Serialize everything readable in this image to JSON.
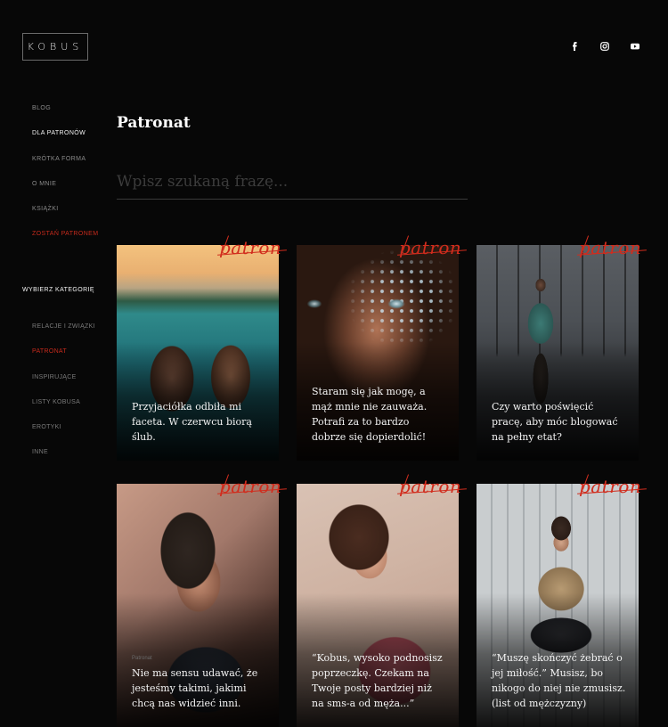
{
  "logo": "KOBUS",
  "social": [
    "facebook-icon",
    "instagram-icon",
    "youtube-icon"
  ],
  "nav": [
    "BLOG",
    "DLA PATRONÓW",
    "KRÓTKA FORMA",
    "O MNIE",
    "KSIĄŻKI",
    "ZOSTAŃ PATRONEM"
  ],
  "categories": {
    "heading": "WYBIERZ KATEGORIĘ",
    "items": [
      "RELACJE I ZWIĄZKI",
      "PATRONAT",
      "INSPIRUJĄCE",
      "LISTY KOBUSA",
      "EROTYKI",
      "INNE"
    ]
  },
  "page_title": "Patronat",
  "search": {
    "placeholder": "Wpisz szukaną frazę..."
  },
  "badge_text": "patron",
  "cards": [
    {
      "caption": "Przyjaciółka odbiła mi faceta. W czerwcu biorą ślub."
    },
    {
      "caption": "Staram się jak mogę, a mąż mnie nie zauważa. Potrafi za to bardzo dobrze się dopierdolić!"
    },
    {
      "caption": "Czy warto poświęcić pracę, aby móc blogować na pełny etat?"
    },
    {
      "caption": "Nie ma sensu udawać, że jesteśmy takimi, jakimi chcą nas widzieć inni.",
      "tag": "Patronat"
    },
    {
      "caption": "“Kobus, wysoko podnosisz poprzeczkę. Czekam na Twoje posty bardziej niż na sms-a od męża...”"
    },
    {
      "caption": "“Muszę skończyć żebrać o jej miłość.” Musisz, bo nikogo do niej nie zmusisz. (list od mężczyzny)"
    }
  ],
  "colors": {
    "accent": "#c62a1c",
    "background": "#070707"
  }
}
